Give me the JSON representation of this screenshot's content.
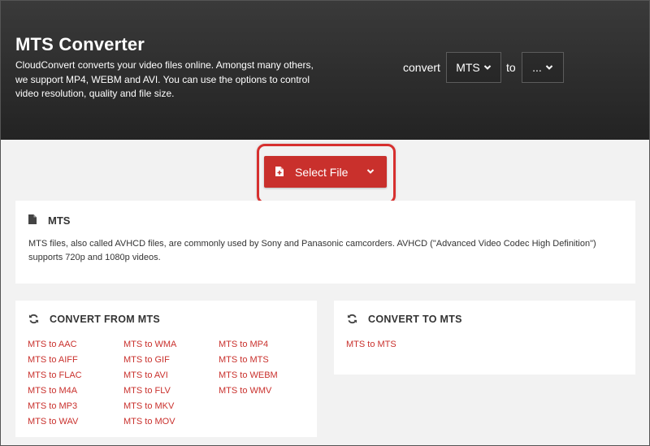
{
  "hero": {
    "title": "MTS Converter",
    "description": "CloudConvert converts your video files online. Amongst many others, we support MP4, WEBM and AVI. You can use the options to control video resolution, quality and file size.",
    "convert_label": "convert",
    "from_value": "MTS",
    "to_label": "to",
    "to_value": "..."
  },
  "select_file": {
    "label": "Select File"
  },
  "info": {
    "title": "MTS",
    "text": "MTS files, also called AVHCD files, are commonly used by Sony and Panasonic camcorders. AVHCD (\"Advanced Video Codec High Definition\") supports 720p and 1080p videos."
  },
  "convert_from": {
    "title": "CONVERT FROM MTS",
    "col1": [
      "MTS to AAC",
      "MTS to AIFF",
      "MTS to FLAC",
      "MTS to M4A",
      "MTS to MP3",
      "MTS to WAV"
    ],
    "col2": [
      "MTS to WMA",
      "MTS to GIF",
      "MTS to AVI",
      "MTS to FLV",
      "MTS to MKV",
      "MTS to MOV"
    ],
    "col3": [
      "MTS to MP4",
      "MTS to MTS",
      "MTS to WEBM",
      "MTS to WMV"
    ]
  },
  "convert_to": {
    "title": "CONVERT TO MTS",
    "links": [
      "MTS to MTS"
    ]
  },
  "colors": {
    "accent": "#c9302c",
    "hero_bg": "#2c2c2c",
    "page_bg": "#f2f2f2",
    "highlight": "#d7302f"
  },
  "icons": {
    "file_plus": "file-plus-icon",
    "document": "document-icon",
    "refresh": "refresh-icon",
    "chevron": "chevron-down-icon"
  }
}
